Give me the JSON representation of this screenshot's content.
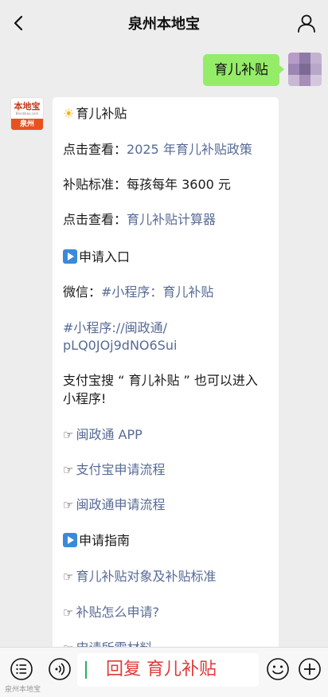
{
  "header": {
    "title": "泉州本地宝"
  },
  "messages": {
    "outgoing": {
      "text": "育儿补贴"
    },
    "incoming": {
      "avatar": {
        "brand": "本地宝",
        "url": "Bendibao.com",
        "city": "泉州"
      },
      "lines": {
        "l1": "育儿补贴",
        "l2_label": "点击查看：",
        "l2_link": "2025 年育儿补贴政策",
        "l3_label": "补贴标准：",
        "l3_value": "每孩每年 3600 元",
        "l4_label": "点击查看：",
        "l4_link": "育儿补贴计算器",
        "l5": "申请入口",
        "l6_label": "微信：",
        "l6_link": "#小程序：育儿补贴",
        "l7a": "#小程序://闽政通/",
        "l7b": "pLQ0JOj9dNO6Sui",
        "l8a": "支付宝搜 “ 育儿补贴 ” 也可以进入",
        "l8b": "小程序!",
        "l9": "闽政通 APP",
        "l10": "支付宝申请流程",
        "l11": "闽政通申请流程",
        "l12": "申请指南",
        "l13": "育儿补贴对象及补贴标准",
        "l14": "补贴怎么申请?",
        "l15": "申请所需材料"
      }
    }
  },
  "input_bar": {
    "text": "回复 育儿补贴"
  },
  "watermark": "泉州本地宝",
  "colors": {
    "bubble_out": "#95ec69",
    "link": "#576b95",
    "reply_text": "#e03a3a"
  }
}
